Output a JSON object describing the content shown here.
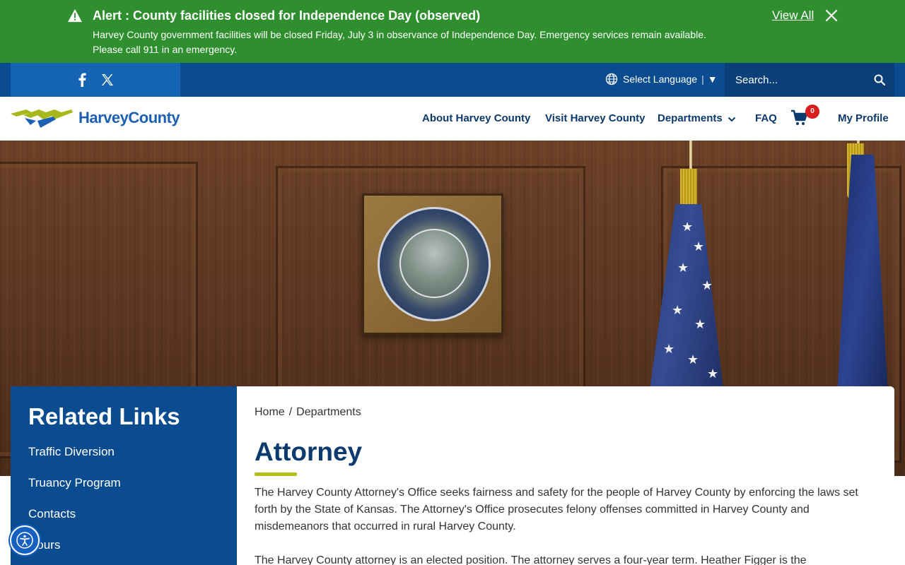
{
  "alert": {
    "title": "Alert : County facilities closed for Independence Day (observed)",
    "body": "Harvey County government facilities will be closed Friday, July 3 in observance of Independence Day. Emergency services remain available. Please call 911 in an emergency.",
    "view_all": "View All",
    "icon": "warning-icon",
    "close_icon": "close-icon"
  },
  "utility": {
    "social": [
      "facebook-icon",
      "x-twitter-icon"
    ],
    "language_label": "Select Language",
    "language_separator": "|",
    "language_arrow": "▼",
    "search_placeholder": "Search..."
  },
  "nav": {
    "logo_text": "HarveyCounty",
    "items": [
      "About Harvey County",
      "Visit Harvey County",
      "Departments",
      "FAQ",
      "My Profile"
    ],
    "cart_count": "0"
  },
  "sidebar": {
    "title": "Related Links",
    "links": [
      "Traffic Diversion",
      "Truancy Program",
      "Contacts",
      "Hours"
    ]
  },
  "content": {
    "breadcrumb": [
      "Home",
      "Departments"
    ],
    "breadcrumb_separator": "/",
    "title": "Attorney",
    "paragraphs": [
      "The Harvey County Attorney's Office seeks fairness and safety for the people of Harvey County by enforcing the laws set forth by the State of Kansas. The Attorney's Office prosecutes felony offenses committed in Harvey County and misdemeanors that occurred in rural Harvey County.",
      "The Harvey County attorney is an elected position. The attorney serves a four-year term. Heather Figger is the"
    ]
  },
  "colors": {
    "alert_green": "#2f8f2f",
    "utility_blue": "#0b4b8f",
    "nav_text": "#0b3a6e",
    "accent_lime": "#b5bf1a",
    "badge_red": "#d81e1e"
  }
}
